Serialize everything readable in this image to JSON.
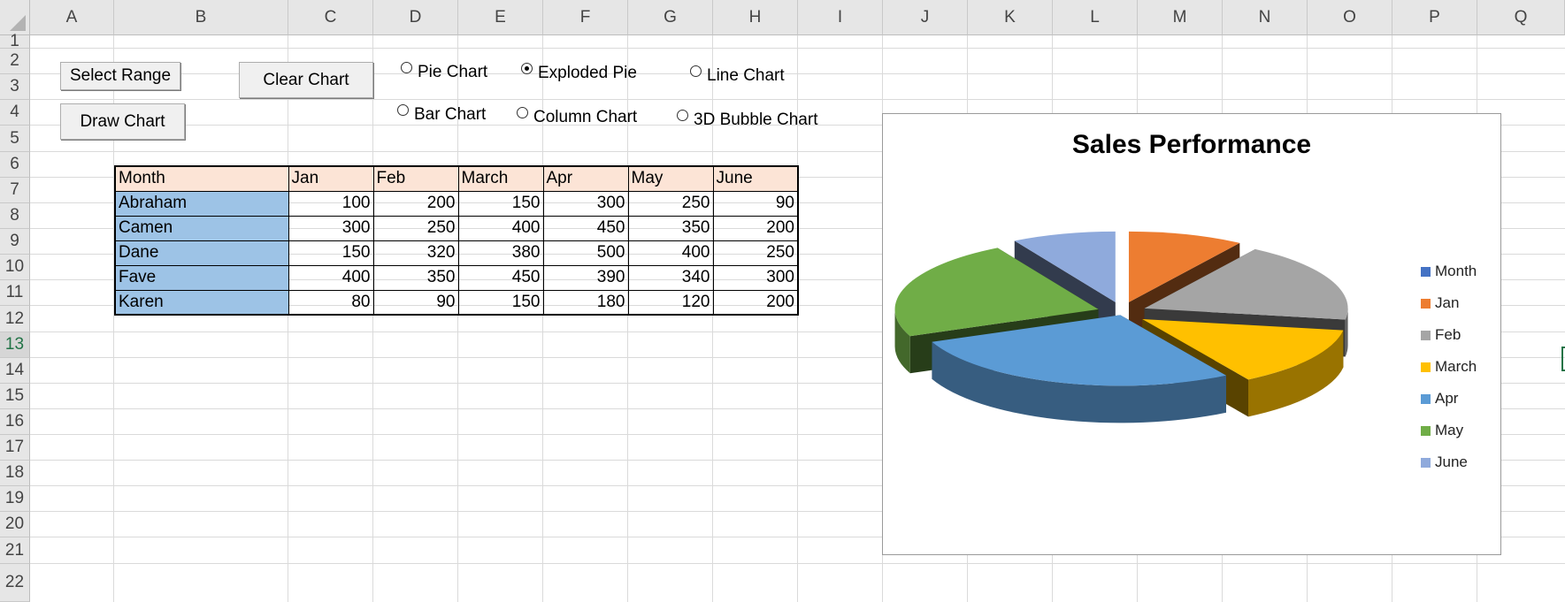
{
  "columns": [
    "A",
    "B",
    "C",
    "D",
    "E",
    "F",
    "G",
    "H",
    "I",
    "J",
    "K",
    "L",
    "M",
    "N",
    "O",
    "P",
    "Q"
  ],
  "rows": [
    "1",
    "2",
    "3",
    "4",
    "5",
    "6",
    "7",
    "8",
    "9",
    "10",
    "11",
    "12",
    "13",
    "14",
    "15",
    "16",
    "17",
    "18",
    "19",
    "20",
    "21",
    "22"
  ],
  "active_row": "13",
  "buttons": {
    "select_range": "Select Range",
    "clear_chart": "Clear Chart",
    "draw_chart": "Draw Chart"
  },
  "radios": [
    {
      "label": "Pie Chart",
      "checked": false
    },
    {
      "label": "Exploded Pie",
      "checked": true
    },
    {
      "label": "Line Chart",
      "checked": false
    },
    {
      "label": "Bar Chart",
      "checked": false
    },
    {
      "label": "Column Chart",
      "checked": false
    },
    {
      "label": "3D Bubble Chart",
      "checked": false
    }
  ],
  "table": {
    "header": [
      "Month",
      "Jan",
      "Feb",
      "March",
      "Apr",
      "May",
      "June"
    ],
    "rows": [
      {
        "name": "Abraham",
        "values": [
          "100",
          "200",
          "150",
          "300",
          "250",
          "90"
        ]
      },
      {
        "name": "Camen",
        "values": [
          "300",
          "250",
          "400",
          "450",
          "350",
          "200"
        ]
      },
      {
        "name": "Dane",
        "values": [
          "150",
          "320",
          "380",
          "500",
          "400",
          "250"
        ]
      },
      {
        "name": "Fave",
        "values": [
          "400",
          "350",
          "450",
          "390",
          "340",
          "300"
        ]
      },
      {
        "name": "Karen",
        "values": [
          "80",
          "90",
          "150",
          "180",
          "120",
          "200"
        ]
      }
    ]
  },
  "chart_data": {
    "type": "pie",
    "variant": "3d-exploded",
    "title": "Sales Performance",
    "categories": [
      "Month",
      "Jan",
      "Feb",
      "March",
      "Apr",
      "May",
      "June"
    ],
    "values": [
      0,
      100,
      200,
      150,
      300,
      250,
      90
    ],
    "colors": [
      "#4472c4",
      "#ed7d31",
      "#a5a5a5",
      "#ffc000",
      "#5b9bd5",
      "#70ad47",
      "#8faadc"
    ],
    "legend_position": "right"
  }
}
